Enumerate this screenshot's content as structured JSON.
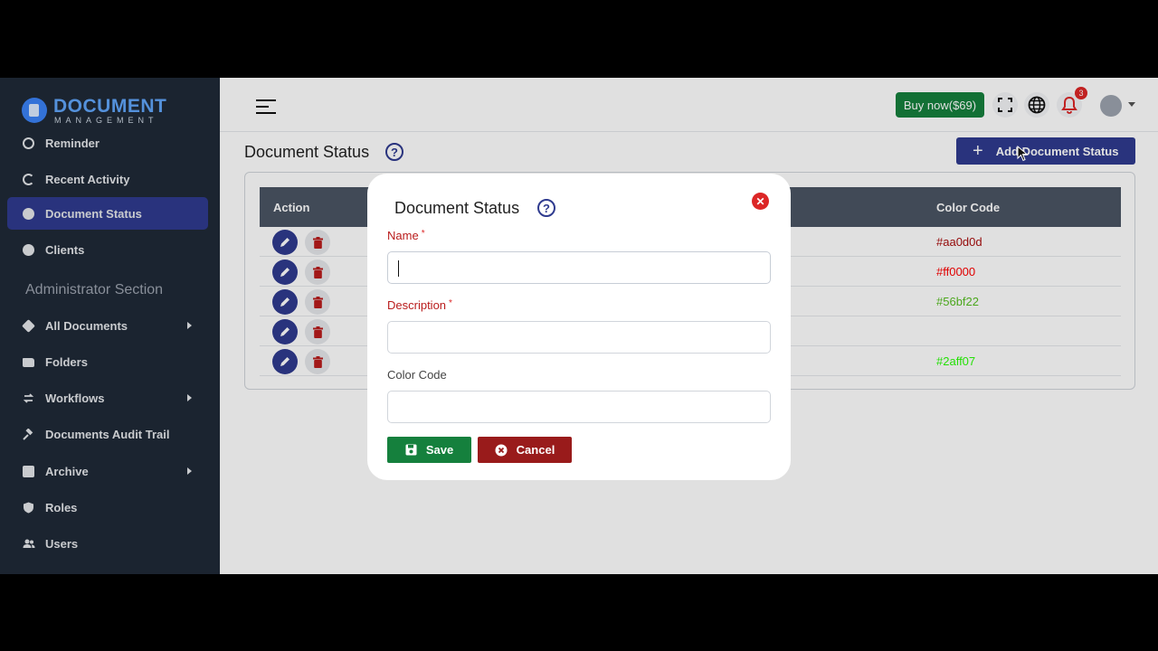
{
  "brand": {
    "title": "DOCUMENT",
    "subtitle": "MANAGEMENT"
  },
  "sidebar": {
    "items": [
      {
        "label": "Reminder",
        "icon": "clock-icon"
      },
      {
        "label": "Recent Activity",
        "icon": "refresh-icon"
      },
      {
        "label": "Document Status",
        "icon": "check-circle-icon",
        "active": true
      },
      {
        "label": "Clients",
        "icon": "user-circle-icon"
      }
    ],
    "section_title": "Administrator Section",
    "admin_items": [
      {
        "label": "All Documents",
        "icon": "layers-icon",
        "has_submenu": true
      },
      {
        "label": "Folders",
        "icon": "folder-icon"
      },
      {
        "label": "Workflows",
        "icon": "workflow-icon",
        "has_submenu": true
      },
      {
        "label": "Documents Audit Trail",
        "icon": "gavel-icon"
      },
      {
        "label": "Archive",
        "icon": "archive-icon",
        "has_submenu": true
      },
      {
        "label": "Roles",
        "icon": "shield-icon"
      },
      {
        "label": "Users",
        "icon": "users-icon"
      }
    ]
  },
  "header": {
    "buy_label": "Buy now($69)",
    "notification_count": "3"
  },
  "page": {
    "title": "Document Status",
    "add_button": "Add Document Status"
  },
  "table": {
    "columns": [
      "Action",
      "Color Code"
    ],
    "rows": [
      {
        "color_code": "#aa0d0d",
        "color": "#aa0d0d"
      },
      {
        "color_code": "#ff0000",
        "color": "#ff0000"
      },
      {
        "color_code": "#56bf22",
        "color": "#56bf22"
      },
      {
        "color_code": "",
        "color": "#ffffff"
      },
      {
        "color_code": "#2aff07",
        "color": "#2aff07"
      }
    ]
  },
  "modal": {
    "title": "Document Status",
    "name_label": "Name",
    "name_value": "",
    "description_label": "Description",
    "description_value": "",
    "color_label": "Color Code",
    "color_value": "",
    "required_mark": "*",
    "save_label": "Save",
    "cancel_label": "Cancel"
  },
  "colors": {
    "sidebar_bg": "#1f2937",
    "accent": "#2f3b8f",
    "success": "#15803d",
    "danger": "#991b1b"
  }
}
